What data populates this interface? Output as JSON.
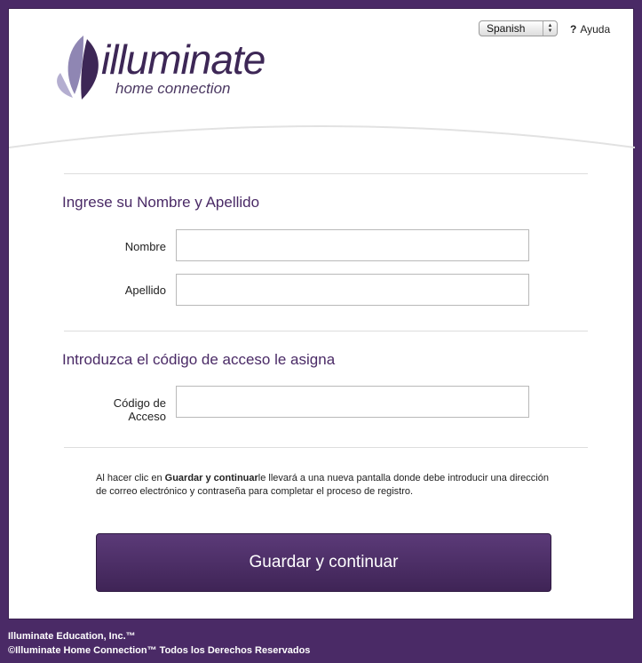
{
  "header": {
    "language": {
      "selected": "Spanish"
    },
    "help": {
      "symbol": "?",
      "label": "Ayuda"
    },
    "logo": {
      "word": "illuminate",
      "tagline": "home connection"
    }
  },
  "form": {
    "name_section": {
      "title": "Ingrese su Nombre y Apellido",
      "first_name_label": "Nombre",
      "first_name_value": "",
      "last_name_label": "Apellido",
      "last_name_value": ""
    },
    "code_section": {
      "title": "Introduzca el código de acceso le asigna",
      "code_label_line1": "Código de",
      "code_label_line2": "Acceso",
      "code_value": ""
    },
    "info": {
      "prefix": "Al hacer clic en ",
      "bold": "Guardar y continuar",
      "suffix": "le llevará a una nueva pantalla donde debe introducir una dirección de correo electrónico y contraseña para completar el proceso de registro."
    },
    "submit_label": "Guardar y continuar"
  },
  "footer": {
    "line1": "Illuminate Education, Inc.™",
    "line2": "©Illuminate Home Connection™ Todos los Derechos Reservados"
  },
  "colors": {
    "brand": "#4a2a66",
    "button": "#4f3169",
    "background": "#4a2a66",
    "card": "#ffffff"
  }
}
